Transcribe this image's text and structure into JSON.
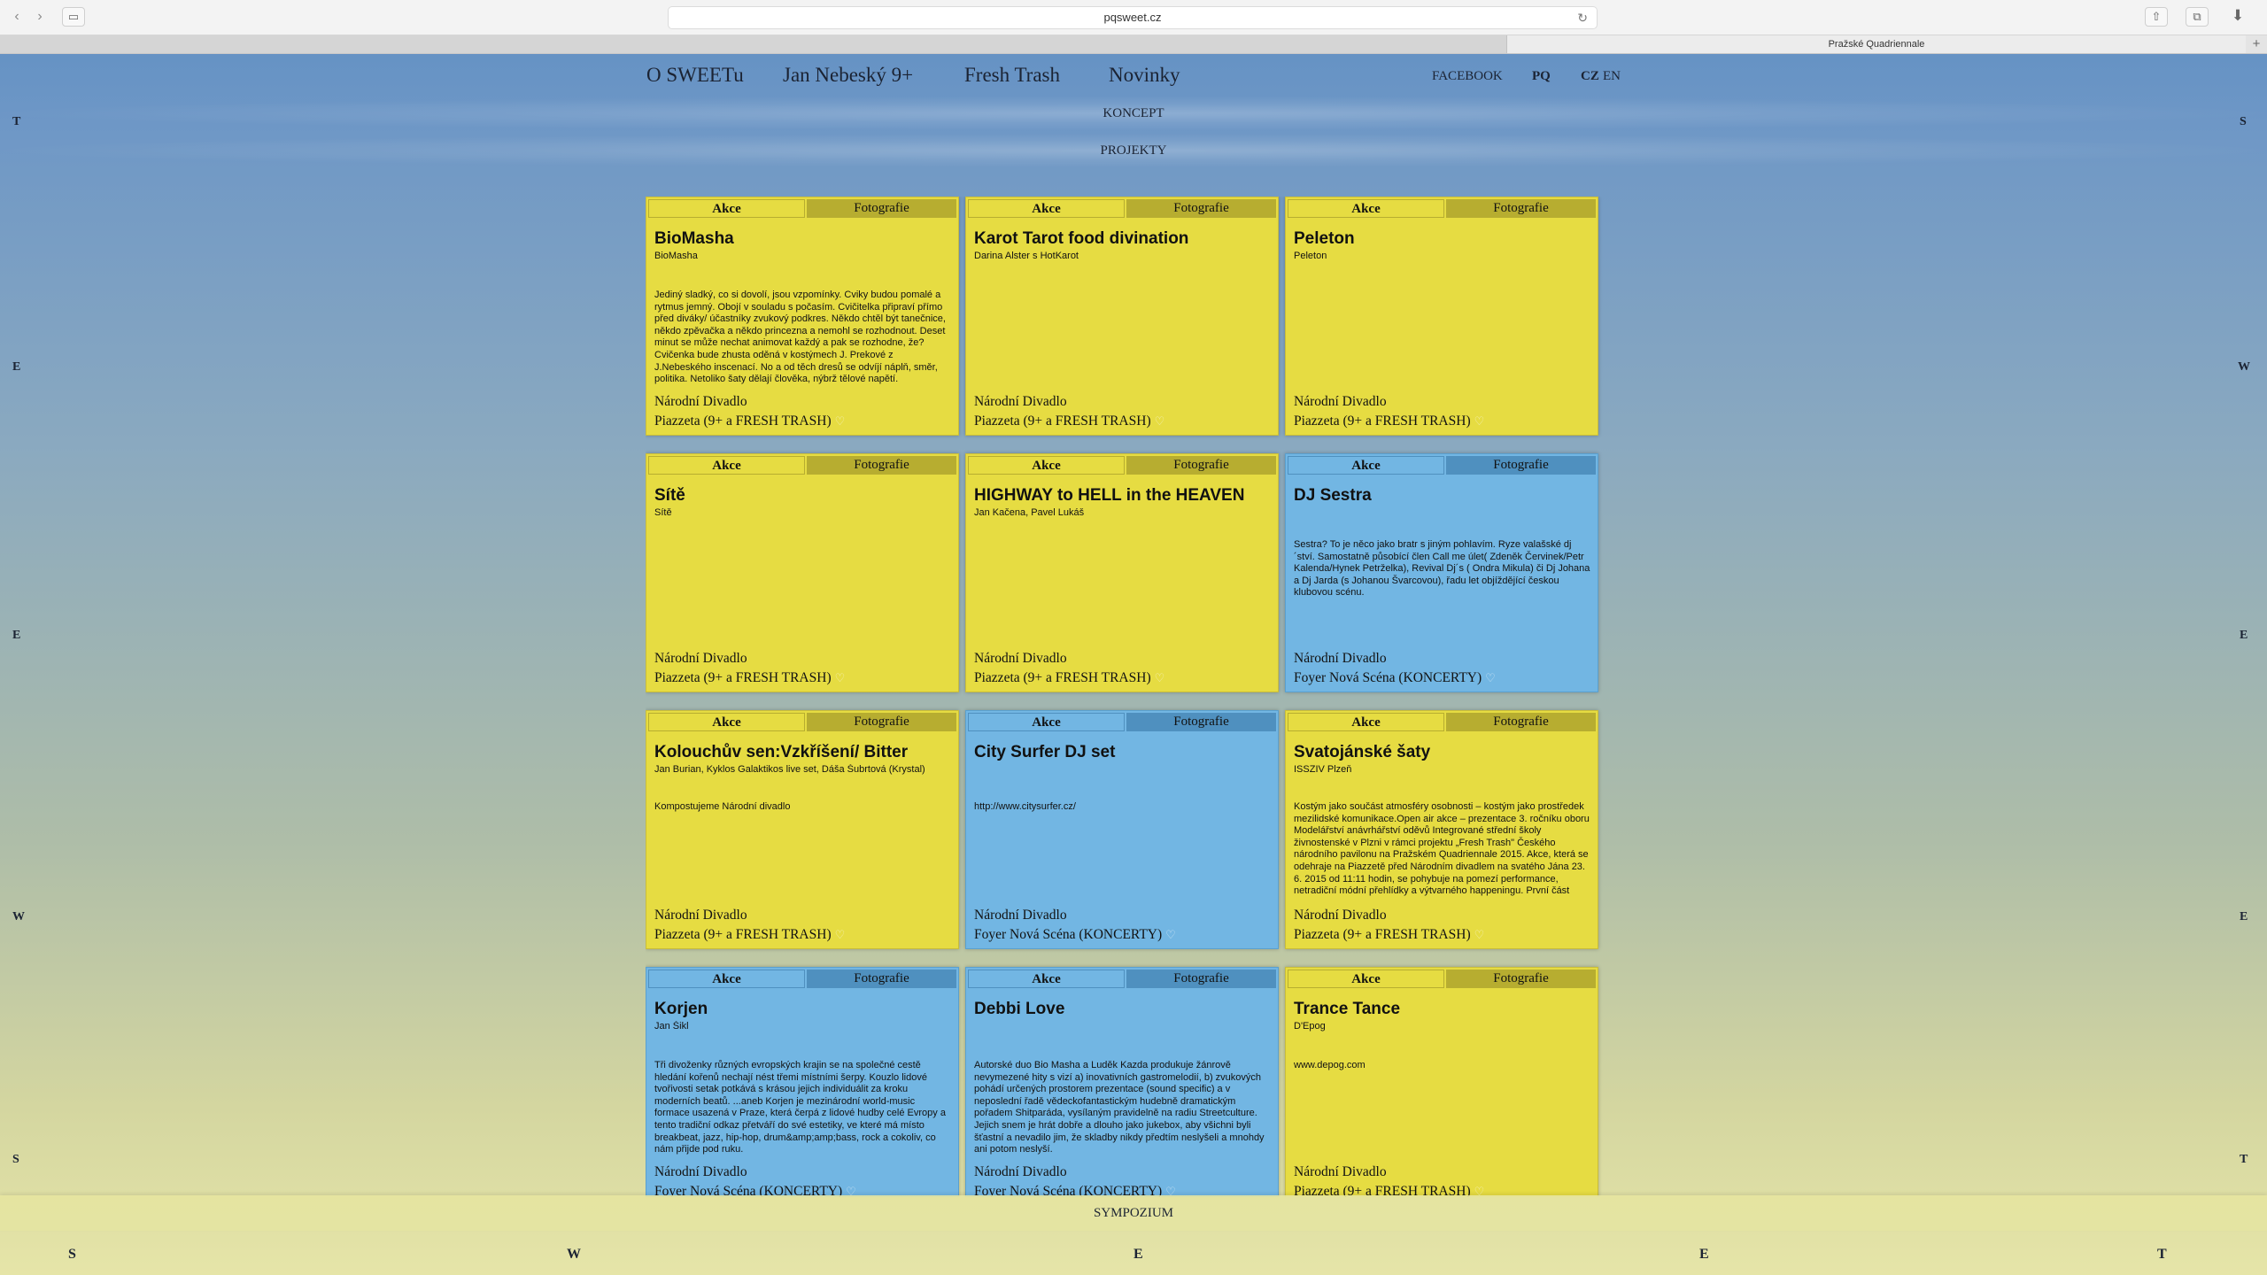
{
  "browser": {
    "url": "pqsweet.cz",
    "tab_title": "Pražské Quadriennale",
    "new_tab": "+"
  },
  "nav": {
    "items": [
      "O SWEETu",
      "Jan Nebeský 9+",
      "Fresh Trash",
      "Novinky"
    ],
    "facebook": "FACEBOOK",
    "pq": "PQ",
    "lang_cz": "CZ",
    "lang_en": "EN"
  },
  "sections": {
    "koncept": "KONCEPT",
    "projekty": "PROJEKTY",
    "sympozium": "SYMPOZIUM"
  },
  "side_letters": {
    "left": [
      "T",
      "E",
      "E",
      "W",
      "S"
    ],
    "right": [
      "S",
      "W",
      "E",
      "E",
      "T"
    ],
    "bottom": [
      "S",
      "W",
      "E",
      "E",
      "T"
    ]
  },
  "colors": {
    "yellow_card": "#e6dc42",
    "blue_card": "#72b6e3"
  },
  "cards": [
    {
      "color": "yellow",
      "tab_akce": "Akce",
      "tab_foto": "Fotografie",
      "title": "BioMasha",
      "author": "BioMasha",
      "desc": "Jediný sladký, co si dovolí, jsou vzpomínky. Cviky budou pomalé a rytmus jemný. Obojí v souladu s počasím. Cvičitelka připraví přímo před diváky/ účastníky zvukový podkres. Někdo chtěl být tanečnice, někdo zpěvačka a někdo princezna a nemohl se rozhodnout. Deset minut se může nechat animovat každý a pak se rozhodne, že? Cvičenka bude zhusta oděná v kostýmech J. Prekové z J.Nebeského inscenací. No a od těch dresů se odvíjí náplň, směr, politika. Netoliko šaty dělají člověka, nýbrž tělové napětí.",
      "venue": "Národní Divadlo",
      "place": "Piazzeta (9+ a FRESH TRASH)"
    },
    {
      "color": "yellow",
      "tab_akce": "Akce",
      "tab_foto": "Fotografie",
      "title": "Karot Tarot food divination",
      "author": "Darina Alster s HotKarot",
      "desc": "",
      "venue": "Národní Divadlo",
      "place": "Piazzeta (9+ a FRESH TRASH)"
    },
    {
      "color": "yellow",
      "tab_akce": "Akce",
      "tab_foto": "Fotografie",
      "title": "Peleton",
      "author": "Peleton",
      "desc": "",
      "venue": "Národní Divadlo",
      "place": "Piazzeta (9+ a FRESH TRASH)"
    },
    {
      "color": "yellow",
      "tab_akce": "Akce",
      "tab_foto": "Fotografie",
      "title": "Sítě",
      "author": "Sítě",
      "desc": "",
      "venue": "Národní Divadlo",
      "place": "Piazzeta (9+ a FRESH TRASH)"
    },
    {
      "color": "yellow",
      "tab_akce": "Akce",
      "tab_foto": "Fotografie",
      "title": "HIGHWAY to HELL in the HEAVEN",
      "author": "Jan Kačena, Pavel Lukáš",
      "desc": "",
      "venue": "Národní Divadlo",
      "place": "Piazzeta (9+ a FRESH TRASH)"
    },
    {
      "color": "blue",
      "tab_akce": "Akce",
      "tab_foto": "Fotografie",
      "title": "DJ Sestra",
      "author": "",
      "desc": "Sestra? To je něco jako bratr s jiným pohlavím. Ryze valašské dj´ství. Samostatně působící člen Call me úlet( Zdeněk Červinek/Petr Kalenda/Hynek Petrželka), Revival Dj´s ( Ondra Mikula) či Dj Johana a Dj Jarda (s Johanou Švarcovou), řadu let objíždějící českou klubovou scénu.",
      "venue": "Národní Divadlo",
      "place": "Foyer Nová Scéna (KONCERTY)"
    },
    {
      "color": "yellow",
      "tab_akce": "Akce",
      "tab_foto": "Fotografie",
      "title": "Kolouchův sen:Vzkříšení/ Bitter",
      "author": "Jan Burian, Kyklos Galaktikos live set, Dáša Šubrtová (Krystal)",
      "desc": "Kompostujeme Národní divadlo",
      "venue": "Národní Divadlo",
      "place": "Piazzeta (9+ a FRESH TRASH)"
    },
    {
      "color": "blue",
      "tab_akce": "Akce",
      "tab_foto": "Fotografie",
      "title": "City Surfer DJ set",
      "author": "",
      "desc": "http://www.citysurfer.cz/",
      "venue": "Národní Divadlo",
      "place": "Foyer Nová Scéna (KONCERTY)"
    },
    {
      "color": "yellow",
      "tab_akce": "Akce",
      "tab_foto": "Fotografie",
      "title": "Svatojánské šaty",
      "author": "ISSZIV Plzeň",
      "desc": "Kostým jako součást atmosféry osobnosti – kostým jako prostředek mezilidské komunikace.Open air akce – prezentace 3. ročníku oboru Modelářství anávrhářství oděvů Integrované střední školy živnostenské v Plzni v rámci projektu „Fresh Trash\" Českého národního pavilonu na Pražském Quadriennale 2015. Akce, která se odehraje na Piazzetě před Národním divadlem na svatého Jána 23. 6. 2015 od 11:11 hodin, se pohybuje na pomezí performance, netradiční módní přehlídky a výtvarného happeningu. První část",
      "venue": "Národní Divadlo",
      "place": "Piazzeta (9+ a FRESH TRASH)"
    },
    {
      "color": "blue",
      "tab_akce": "Akce",
      "tab_foto": "Fotografie",
      "title": "Korjen",
      "author": "Jan Šikl",
      "desc": "Tři divoženky různých evropských krajin se na společné cestě hledání kořenů nechají nést třemi místními šerpy. Kouzlo lidové tvořivosti setak potkává s krásou jejich individuálit za kroku moderních beatů. ...aneb Korjen je mezinárodní world-music formace usazená v Praze, která čerpá z lidové hudby celé Evropy a tento tradiční odkaz přetváří do své estetiky, ve které má místo breakbeat, jazz, hip-hop, drum&amp;amp;bass, rock a cokoliv, co nám přijde pod ruku.",
      "venue": "Národní Divadlo",
      "place": "Foyer Nová Scéna (KONCERTY)"
    },
    {
      "color": "blue",
      "tab_akce": "Akce",
      "tab_foto": "Fotografie",
      "title": "Debbi Love",
      "author": "",
      "desc": "Autorské duo Bio Masha a Luděk Kazda produkuje žánrově nevymezené hity s vizí a) inovativních gastromelodií, b) zvukových pohádí určených prostorem prezentace (sound specific) a v neposlední řadě vědeckofantastickým hudebně dramatickým pořadem Shitparáda, vysílaným pravidelně na radiu Streetculture. Jejich snem je hrát dobře a dlouho jako jukebox, aby všichni byli šťastní a nevadilo jim, že skladby nikdy předtím neslyšeli a mnohdy ani potom neslyší.",
      "venue": "Národní Divadlo",
      "place": "Foyer Nová Scéna (KONCERTY)"
    },
    {
      "color": "yellow",
      "tab_akce": "Akce",
      "tab_foto": "Fotografie",
      "title": "Trance Tance",
      "author": "D'Epog",
      "desc": "www.depog.com",
      "venue": "Národní Divadlo",
      "place": "Piazzeta (9+ a FRESH TRASH)"
    }
  ]
}
